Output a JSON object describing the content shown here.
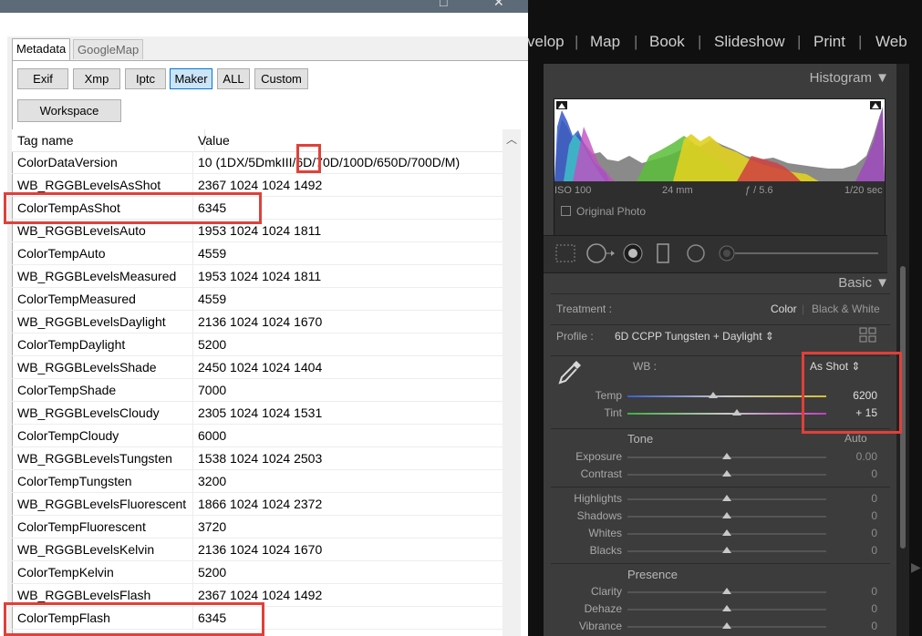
{
  "exiftool": {
    "window_buttons": {
      "restore": "□",
      "close": "✕"
    },
    "tabs": [
      {
        "label": "Metadata"
      },
      {
        "label": "GoogleMap"
      }
    ],
    "buttons": [
      "Exif",
      "Xmp",
      "Iptc",
      "Maker",
      "ALL",
      "Custom"
    ],
    "active_button": "Maker",
    "workspace_label": "Workspace",
    "columns": {
      "tag": "Tag name",
      "value": "Value"
    },
    "rows": [
      {
        "tag": "ColorDataVersion",
        "value": "10 (1DX/5DmkIII/6D/70D/100D/650D/700D/M)"
      },
      {
        "tag": "WB_RGGBLevelsAsShot",
        "value": "2367 1024 1024 1492"
      },
      {
        "tag": "ColorTempAsShot",
        "value": "6345"
      },
      {
        "tag": "WB_RGGBLevelsAuto",
        "value": "1953 1024 1024 1811"
      },
      {
        "tag": "ColorTempAuto",
        "value": "4559"
      },
      {
        "tag": "WB_RGGBLevelsMeasured",
        "value": "1953 1024 1024 1811"
      },
      {
        "tag": "ColorTempMeasured",
        "value": "4559"
      },
      {
        "tag": "WB_RGGBLevelsDaylight",
        "value": "2136 1024 1024 1670"
      },
      {
        "tag": "ColorTempDaylight",
        "value": "5200"
      },
      {
        "tag": "WB_RGGBLevelsShade",
        "value": "2450 1024 1024 1404"
      },
      {
        "tag": "ColorTempShade",
        "value": "7000"
      },
      {
        "tag": "WB_RGGBLevelsCloudy",
        "value": "2305 1024 1024 1531"
      },
      {
        "tag": "ColorTempCloudy",
        "value": "6000"
      },
      {
        "tag": "WB_RGGBLevelsTungsten",
        "value": "1538 1024 1024 2503"
      },
      {
        "tag": "ColorTempTungsten",
        "value": "3200"
      },
      {
        "tag": "WB_RGGBLevelsFluorescent",
        "value": "1866 1024 1024 2372"
      },
      {
        "tag": "ColorTempFluorescent",
        "value": "3720"
      },
      {
        "tag": "WB_RGGBLevelsKelvin",
        "value": "2136 1024 1024 1670"
      },
      {
        "tag": "ColorTempKelvin",
        "value": "5200"
      },
      {
        "tag": "WB_RGGBLevelsFlash",
        "value": "2367 1024 1024 1492"
      },
      {
        "tag": "ColorTempFlash",
        "value": "6345"
      }
    ]
  },
  "lightroom": {
    "modules": [
      "velop",
      "Map",
      "Book",
      "Slideshow",
      "Print",
      "Web"
    ],
    "histogram": {
      "title": "Histogram",
      "iso": "ISO 100",
      "focal": "24 mm",
      "aperture": "ƒ / 5.6",
      "shutter": "1/20 sec",
      "original_photo": "Original Photo"
    },
    "basic": {
      "title": "Basic",
      "treatment_label": "Treatment :",
      "treatment_color": "Color",
      "treatment_bw": "Black & White",
      "profile_label": "Profile :",
      "profile_value": "6D CCPP Tungsten + Daylight",
      "wb_label": "WB :",
      "wb_value": "As Shot",
      "sliders": {
        "temp": {
          "label": "Temp",
          "value": "6200",
          "position": 0.43
        },
        "tint": {
          "label": "Tint",
          "value": "+ 15",
          "position": 0.55
        }
      },
      "tone_label": "Tone",
      "auto_label": "Auto",
      "tone_sliders": [
        {
          "label": "Exposure",
          "value": "0.00",
          "position": 0.5
        },
        {
          "label": "Contrast",
          "value": "0",
          "position": 0.5
        }
      ],
      "tone_sliders2": [
        {
          "label": "Highlights",
          "value": "0",
          "position": 0.5
        },
        {
          "label": "Shadows",
          "value": "0",
          "position": 0.5
        },
        {
          "label": "Whites",
          "value": "0",
          "position": 0.5
        },
        {
          "label": "Blacks",
          "value": "0",
          "position": 0.5
        }
      ],
      "presence_label": "Presence",
      "presence_sliders": [
        {
          "label": "Clarity",
          "value": "0",
          "position": 0.5
        },
        {
          "label": "Dehaze",
          "value": "0",
          "position": 0.5
        },
        {
          "label": "Vibrance",
          "value": "0",
          "position": 0.5
        }
      ]
    }
  },
  "colors": {
    "highlight": "#e0403a",
    "lr_panel": "#3c3c3c",
    "active_button": "#cce4f7"
  }
}
